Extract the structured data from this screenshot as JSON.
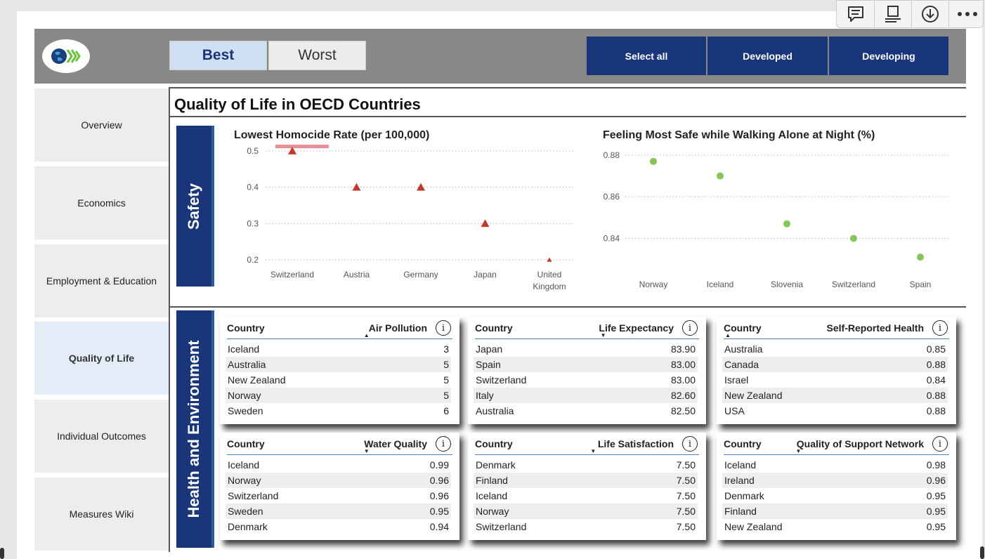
{
  "header": {
    "logo_icon": "oecd-logo",
    "toggle": {
      "best": "Best",
      "worst": "Worst",
      "selected": "Best"
    },
    "filters": [
      "Select all",
      "Developed",
      "Developing"
    ]
  },
  "toolbar": {
    "icons": [
      "comment-icon",
      "focus-mode-icon",
      "download-icon",
      "more-options-icon"
    ]
  },
  "sidebar": {
    "items": [
      {
        "label": "Overview"
      },
      {
        "label": "Economics"
      },
      {
        "label": "Employment & Education"
      },
      {
        "label": "Quality of Life",
        "active": true
      },
      {
        "label": "Individual Outcomes"
      },
      {
        "label": "Measures Wiki"
      }
    ]
  },
  "page": {
    "title": "Quality of Life in OECD Countries"
  },
  "sections": {
    "safety": "Safety",
    "health": "Health and Environment"
  },
  "colors": {
    "navy": "#183679",
    "triangle_marker": "#c0392b",
    "dot_marker": "#86c55a",
    "highlight_bar": "#e8909a"
  },
  "chart_data": [
    {
      "type": "scatter",
      "title": "Lowest Homocide Rate (per 100,000)",
      "marker": "triangle",
      "categories": [
        "Switzerland",
        "Austria",
        "Germany",
        "Japan",
        "United Kingdom"
      ],
      "category_lines": [
        [
          "Switzerland"
        ],
        [
          "Austria"
        ],
        [
          "Germany"
        ],
        [
          "Japan"
        ],
        [
          "United",
          "Kingdom"
        ]
      ],
      "values": [
        0.5,
        0.4,
        0.4,
        0.3,
        0.2
      ],
      "yticks": [
        0.5,
        0.4,
        0.3,
        0.2
      ],
      "ylim": [
        0.2,
        0.5
      ],
      "grid": true
    },
    {
      "type": "scatter",
      "title": "Feeling Most Safe while Walking Alone at Night (%)",
      "marker": "circle",
      "categories": [
        "Norway",
        "Iceland",
        "Slovenia",
        "Switzerland",
        "Spain"
      ],
      "category_lines": [
        [
          "Norway"
        ],
        [
          "Iceland"
        ],
        [
          "Slovenia"
        ],
        [
          "Switzerland"
        ],
        [
          "Spain"
        ]
      ],
      "values": [
        0.877,
        0.87,
        0.847,
        0.84,
        0.831
      ],
      "yticks": [
        0.88,
        0.86,
        0.84
      ],
      "ylim": [
        0.828,
        0.882
      ],
      "grid": true
    }
  ],
  "tables": [
    {
      "col1": "Country",
      "col2": "Air Pollution",
      "sort": "up",
      "rows": [
        [
          "Iceland",
          "3"
        ],
        [
          "Australia",
          "5"
        ],
        [
          "New Zealand",
          "5"
        ],
        [
          "Norway",
          "5"
        ],
        [
          "Sweden",
          "6"
        ]
      ]
    },
    {
      "col1": "Country",
      "col2": "Life Expectancy",
      "sort": "down",
      "rows": [
        [
          "Japan",
          "83.90"
        ],
        [
          "Spain",
          "83.00"
        ],
        [
          "Switzerland",
          "83.00"
        ],
        [
          "Italy",
          "82.60"
        ],
        [
          "Australia",
          "82.50"
        ]
      ]
    },
    {
      "col1": "Country",
      "col2": "Self-Reported Health",
      "sort": "up-left",
      "rows": [
        [
          "Australia",
          "0.85"
        ],
        [
          "Canada",
          "0.88"
        ],
        [
          "Israel",
          "0.84"
        ],
        [
          "New Zealand",
          "0.88"
        ],
        [
          "USA",
          "0.88"
        ]
      ]
    },
    {
      "col1": "Country",
      "col2": "Water Quality",
      "sort": "down",
      "rows": [
        [
          "Iceland",
          "0.99"
        ],
        [
          "Norway",
          "0.96"
        ],
        [
          "Switzerland",
          "0.96"
        ],
        [
          "Sweden",
          "0.95"
        ],
        [
          "Denmark",
          "0.94"
        ]
      ]
    },
    {
      "col1": "Country",
      "col2": "Life Satisfaction",
      "sort": "down",
      "rows": [
        [
          "Denmark",
          "7.50"
        ],
        [
          "Finland",
          "7.50"
        ],
        [
          "Iceland",
          "7.50"
        ],
        [
          "Norway",
          "7.50"
        ],
        [
          "Switzerland",
          "7.50"
        ]
      ]
    },
    {
      "col1": "Country",
      "col2": "Quality of Support Network",
      "sort": "down",
      "rows": [
        [
          "Iceland",
          "0.98"
        ],
        [
          "Ireland",
          "0.96"
        ],
        [
          "Denmark",
          "0.95"
        ],
        [
          "Finland",
          "0.95"
        ],
        [
          "New Zealand",
          "0.95"
        ]
      ]
    }
  ]
}
